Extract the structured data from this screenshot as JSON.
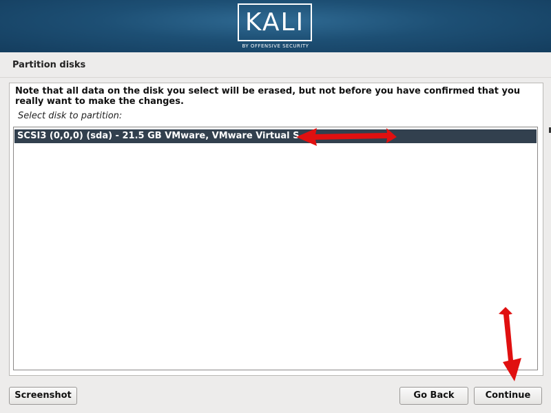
{
  "header": {
    "logo_text": "KALI",
    "logo_tagline": "BY OFFENSIVE SECURITY"
  },
  "page": {
    "title": "Partition disks"
  },
  "content": {
    "note": "Note that all data on the disk you select will be erased, but not before you have confirmed that you really want to make the changes.",
    "prompt": "Select disk to partition:",
    "disks": [
      {
        "label": "SCSI3 (0,0,0) (sda) - 21.5 GB VMware, VMware Virtual S",
        "selected": true
      }
    ]
  },
  "buttons": {
    "screenshot": "Screenshot",
    "go_back": "Go Back",
    "continue": "Continue"
  },
  "colors": {
    "banner": "#1d4f74",
    "selected_row": "#32404e",
    "annotation_arrow": "#e01010"
  }
}
